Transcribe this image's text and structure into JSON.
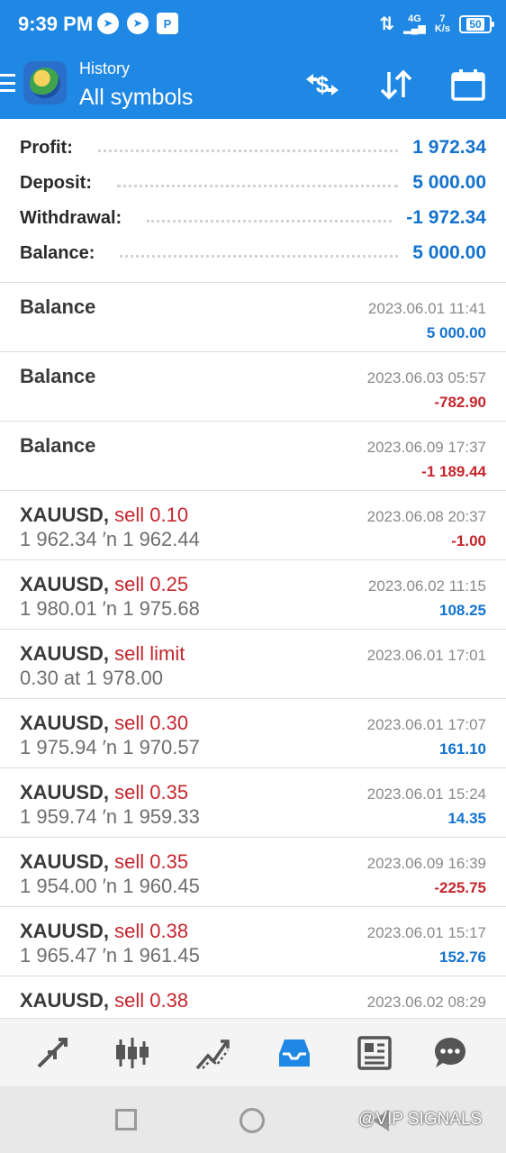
{
  "status_bar": {
    "time": "9:39 PM",
    "app_icons": [
      "telegram-icon",
      "telegram-icon",
      "parking-app-icon"
    ],
    "app_glyphs": [
      "➤",
      "➤",
      "P"
    ],
    "network": "4G",
    "speed_top": "7",
    "speed_unit": "K/s",
    "battery": "50"
  },
  "appbar": {
    "subtitle": "History",
    "title": "All symbols",
    "accent_color": "#1f88e4"
  },
  "summary": {
    "profit_label": "Profit:",
    "profit_value": "1 972.34",
    "deposit_label": "Deposit:",
    "deposit_value": "5 000.00",
    "withdrawal_label": "Withdrawal:",
    "withdrawal_value": "-1 972.34",
    "balance_label": "Balance:",
    "balance_value": "5 000.00"
  },
  "deals": [
    {
      "symbol": "Balance",
      "type": "",
      "prices": "",
      "time": "2023.06.01 11:41",
      "profit": "5 000.00",
      "profit_sign": "pos"
    },
    {
      "symbol": "Balance",
      "type": "",
      "prices": "",
      "time": "2023.06.03 05:57",
      "profit": "-782.90",
      "profit_sign": "neg"
    },
    {
      "symbol": "Balance",
      "type": "",
      "prices": "",
      "time": "2023.06.09 17:37",
      "profit": "-1 189.44",
      "profit_sign": "neg"
    },
    {
      "symbol": "XAUUSD,",
      "type": "sell 0.10",
      "prices": "1 962.34 ′n  1 962.44",
      "time": "2023.06.08 20:37",
      "profit": "-1.00",
      "profit_sign": "neg"
    },
    {
      "symbol": "XAUUSD,",
      "type": "sell 0.25",
      "prices": "1 980.01 ′n  1 975.68",
      "time": "2023.06.02 11:15",
      "profit": "108.25",
      "profit_sign": "pos"
    },
    {
      "symbol": "XAUUSD,",
      "type": "sell limit",
      "prices": "0.30 at 1 978.00",
      "time": "2023.06.01 17:01",
      "profit": "",
      "profit_sign": "pos"
    },
    {
      "symbol": "XAUUSD,",
      "type": "sell 0.30",
      "prices": "1 975.94 ′n  1 970.57",
      "time": "2023.06.01 17:07",
      "profit": "161.10",
      "profit_sign": "pos"
    },
    {
      "symbol": "XAUUSD,",
      "type": "sell 0.35",
      "prices": "1 959.74 ′n  1 959.33",
      "time": "2023.06.01 15:24",
      "profit": "14.35",
      "profit_sign": "pos"
    },
    {
      "symbol": "XAUUSD,",
      "type": "sell 0.35",
      "prices": "1 954.00 ′n  1 960.45",
      "time": "2023.06.09 16:39",
      "profit": "-225.75",
      "profit_sign": "neg"
    },
    {
      "symbol": "XAUUSD,",
      "type": "sell 0.38",
      "prices": "1 965.47 ′n  1 961.45",
      "time": "2023.06.01 15:17",
      "profit": "152.76",
      "profit_sign": "pos"
    },
    {
      "symbol": "XAUUSD,",
      "type": "sell 0.38",
      "prices": "",
      "time": "2023.06.02 08:29",
      "profit": "",
      "profit_sign": "pos"
    }
  ],
  "bottom_nav": {
    "items": [
      "quotes-arrows-icon",
      "chart-candles-icon",
      "trade-icon",
      "history-inbox-icon",
      "news-icon",
      "chat-icon"
    ],
    "active_index": 3,
    "active_color": "#1f88e4",
    "inactive_color": "#555555"
  },
  "watermark": "@VIP SIGNALS"
}
